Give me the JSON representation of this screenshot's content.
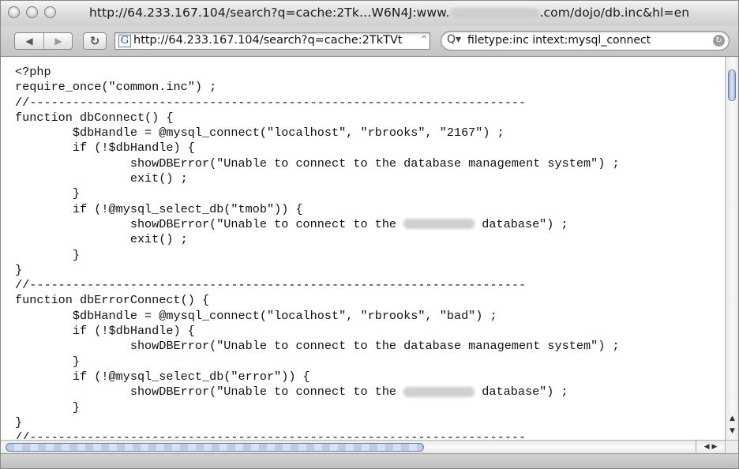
{
  "window": {
    "title_prefix": "http://64.233.167.104/search?q=cache:2Tk…W6N4J:www.",
    "title_suffix": ".com/dojo/db.inc&hl=en"
  },
  "toolbar": {
    "back_glyph": "◀",
    "forward_glyph": "▶",
    "reload_glyph": "↻",
    "url": "http://64.233.167.104/search?q=cache:2TkTVt",
    "favicon_letter": "G",
    "search_value": "filetype:inc intext:mysql_connect",
    "search_icon_glyph": "Q▾",
    "search_clear_glyph": "↻"
  },
  "code_lines": [
    "<?php",
    "require_once(\"common.inc\") ;",
    "//---------------------------------------------------------------------",
    "function dbConnect() {",
    "        $dbHandle = @mysql_connect(\"localhost\", \"rbrooks\", \"2167\") ;",
    "        if (!$dbHandle) {",
    "                showDBError(\"Unable to connect to the database management system\") ;",
    "                exit() ;",
    "        }",
    "        if (!@mysql_select_db(\"tmob\")) {",
    "                showDBError(\"Unable to connect to the ",
    " database\") ;",
    "                exit() ;",
    "        }",
    "}",
    "//---------------------------------------------------------------------",
    "function dbErrorConnect() {",
    "        $dbHandle = @mysql_connect(\"localhost\", \"rbrooks\", \"bad\") ;",
    "        if (!$dbHandle) {",
    "                showDBError(\"Unable to connect to the database management system\") ;",
    "        }",
    "        if (!@mysql_select_db(\"error\")) {",
    "                showDBError(\"Unable to connect to the ",
    " database\") ;",
    "        }",
    "}",
    "//---------------------------------------------------------------------"
  ]
}
